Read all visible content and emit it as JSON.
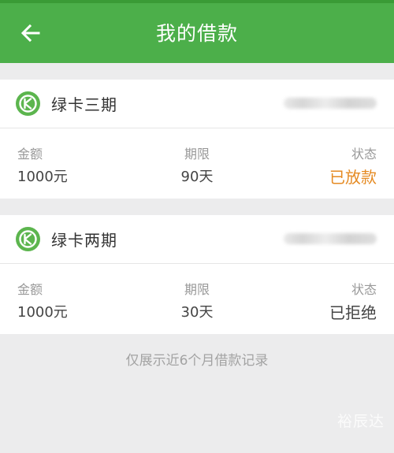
{
  "header": {
    "title": "我的借款"
  },
  "loans": [
    {
      "name": "绿卡三期",
      "amount_label": "金额",
      "amount": "1000元",
      "term_label": "期限",
      "term": "90天",
      "status_label": "状态",
      "status": "已放款",
      "status_color": "#e58a22"
    },
    {
      "name": "绿卡两期",
      "amount_label": "金额",
      "amount": "1000元",
      "term_label": "期限",
      "term": "30天",
      "status_label": "状态",
      "status": "已拒绝",
      "status_color": "#444444"
    }
  ],
  "footer_note": "仅展示近6个月借款记录",
  "watermark": "裕辰达",
  "colors": {
    "brand_green": "#4caf4a",
    "status_disbursed": "#e58a22",
    "status_rejected": "#444444"
  },
  "icons": {
    "back": "arrow-left-icon",
    "brand": "greencard-logo-icon"
  }
}
